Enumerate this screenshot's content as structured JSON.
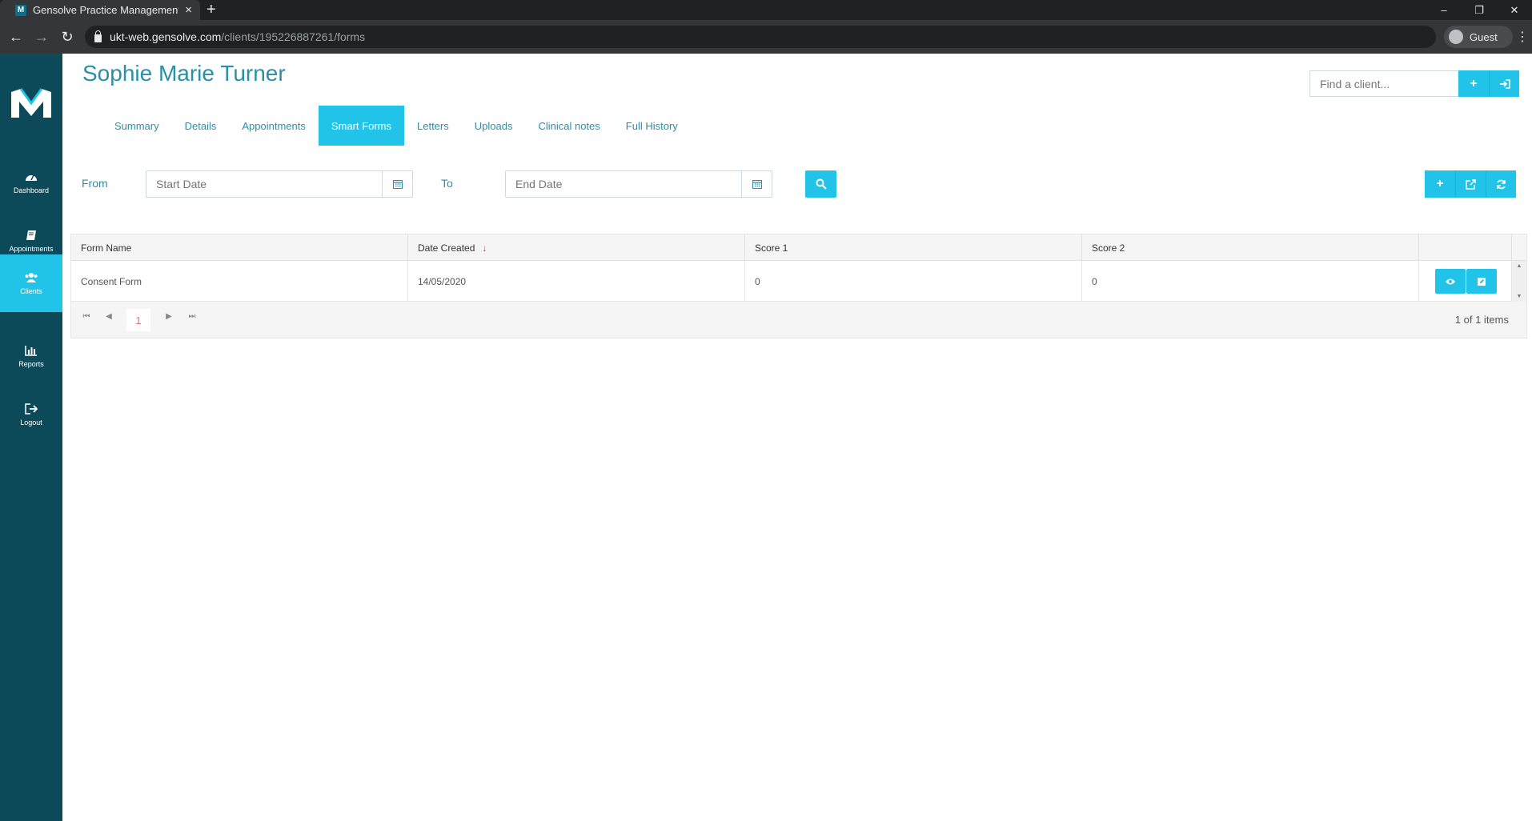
{
  "browser": {
    "tab_title": "Gensolve Practice Management",
    "tab_favicon_letter": "M",
    "url_host": "ukt-web.gensolve.com",
    "url_path": "/clients/195226887261/forms",
    "profile_label": "Guest"
  },
  "sidebar": {
    "items": [
      {
        "label": "Dashboard",
        "icon": "dashboard-icon"
      },
      {
        "label": "Appointments",
        "icon": "book-icon"
      },
      {
        "label": "Clients",
        "icon": "users-icon",
        "active": true
      },
      {
        "label": "Reports",
        "icon": "bar-chart-icon"
      },
      {
        "label": "Logout",
        "icon": "sign-out-icon"
      }
    ]
  },
  "header": {
    "client_name": "Sophie Marie Turner",
    "find_placeholder": "Find a client..."
  },
  "tabs": [
    {
      "label": "Summary"
    },
    {
      "label": "Details"
    },
    {
      "label": "Appointments"
    },
    {
      "label": "Smart Forms",
      "active": true
    },
    {
      "label": "Letters"
    },
    {
      "label": "Uploads"
    },
    {
      "label": "Clinical notes"
    },
    {
      "label": "Full History"
    }
  ],
  "filters": {
    "from_label": "From",
    "to_label": "To",
    "start_placeholder": "Start Date",
    "end_placeholder": "End Date"
  },
  "grid": {
    "columns": [
      "Form Name",
      "Date Created",
      "Score 1",
      "Score 2"
    ],
    "sorted_column": "Date Created",
    "sort_direction": "descending",
    "rows": [
      {
        "form_name": "Consent Form",
        "date_created": "14/05/2020",
        "score1": "0",
        "score2": "0"
      }
    ],
    "pager": {
      "current_page": "1",
      "info": "1 of 1 items"
    }
  },
  "colors": {
    "accent": "#21c4e8",
    "sidebar": "#0c4a5a",
    "heading": "#2a8fa8",
    "sort_arrow": "#e53935"
  }
}
